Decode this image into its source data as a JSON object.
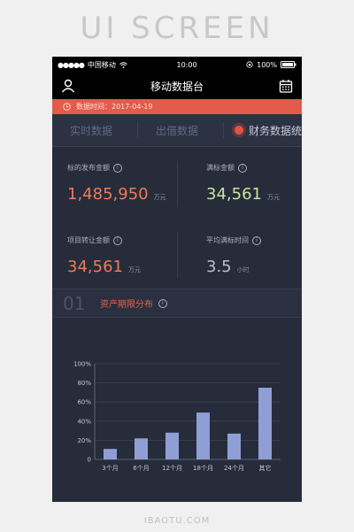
{
  "poster": {
    "title": "UI SCREEN",
    "watermark": "IBAOTU.COM"
  },
  "status_bar": {
    "carrier": "中国移动",
    "time": "10:00",
    "battery": "100%"
  },
  "nav": {
    "title": "移动数据台",
    "left_icon": "user-icon",
    "right_icon": "calendar-icon"
  },
  "date_bar": {
    "label": "数据时间：2017-04-19",
    "icon": "clock-icon"
  },
  "tabs": [
    {
      "label": "实时数据",
      "active": false
    },
    {
      "label": "出借数据",
      "active": false
    },
    {
      "label": "财务数据统",
      "active": true
    }
  ],
  "stats": [
    {
      "label": "标的发布金额",
      "value": "1,485,950",
      "unit": "万元",
      "color": "#f07a5a"
    },
    {
      "label": "满标金额",
      "value": "34,561",
      "unit": "万元",
      "color": "#c7e3a0"
    },
    {
      "label": "项目转让金额",
      "value": "34,561",
      "unit": "万元",
      "color": "#f07a5a"
    },
    {
      "label": "平均满标时间",
      "value": "3.5",
      "unit": "小时",
      "color": "#b7bfcf"
    }
  ],
  "section": {
    "index": "01",
    "title": "资产期限分布"
  },
  "chart_data": {
    "type": "bar",
    "categories": [
      "3个月",
      "6个月",
      "12个月",
      "18个月",
      "24个月",
      "其它"
    ],
    "values": [
      11,
      22,
      28,
      49,
      27,
      75
    ],
    "ytick_labels": [
      "0",
      "20%",
      "40%",
      "60%",
      "80%",
      "100%"
    ],
    "ylim": [
      0,
      100
    ],
    "bar_color": "#8f9fd6",
    "grid": true
  }
}
